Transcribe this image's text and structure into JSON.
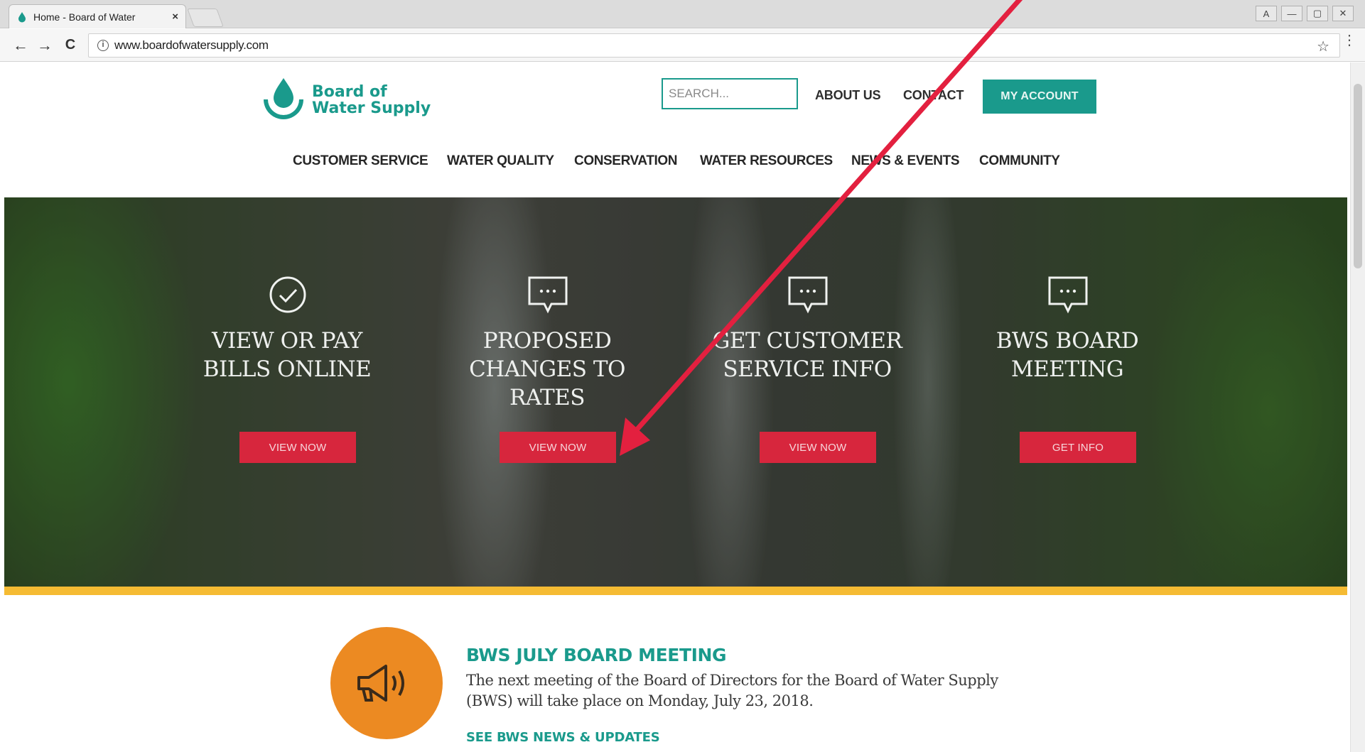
{
  "browser": {
    "tab_title": "Home - Board of Water",
    "tab_close": "×",
    "url": "www.boardofwatersupply.com",
    "info_glyph": "i",
    "star_glyph": "☆",
    "back_glyph": "←",
    "forward_glyph": "→",
    "reload_glyph": "C",
    "menu_glyph": "⋮",
    "window_controls": [
      "A",
      "—",
      "▢",
      "✕"
    ]
  },
  "header": {
    "logo_line1": "Board of",
    "logo_line2": "Water Supply",
    "search_placeholder": "SEARCH...",
    "about_label": "ABOUT US",
    "contact_label": "CONTACT",
    "account_label": "MY ACCOUNT"
  },
  "nav": {
    "items": [
      {
        "label": "CUSTOMER SERVICE"
      },
      {
        "label": "WATER QUALITY"
      },
      {
        "label": "CONSERVATION"
      },
      {
        "label": "WATER RESOURCES"
      },
      {
        "label": "NEWS & EVENTS"
      },
      {
        "label": "COMMUNITY"
      }
    ]
  },
  "hero": {
    "ctas": [
      {
        "icon": "check-circle-icon",
        "title_lines": [
          "VIEW OR PAY",
          "BILLS ONLINE"
        ],
        "button": "VIEW NOW"
      },
      {
        "icon": "chat-bubble-icon",
        "title_lines": [
          "PROPOSED",
          "CHANGES TO",
          "RATES"
        ],
        "button": "VIEW NOW"
      },
      {
        "icon": "chat-bubble-icon",
        "title_lines": [
          "GET CUSTOMER",
          "SERVICE INFO"
        ],
        "button": "VIEW NOW"
      },
      {
        "icon": "chat-bubble-icon",
        "title_lines": [
          "BWS BOARD",
          "MEETING"
        ],
        "button": "GET INFO"
      }
    ]
  },
  "news": {
    "icon": "megaphone-icon",
    "title": "BWS JULY BOARD MEETING",
    "body_line1": "The next meeting of the Board of Directors for the Board of Water Supply",
    "body_line2": "(BWS) will take place on Monday, July 23, 2018.",
    "link": "SEE BWS NEWS & UPDATES"
  },
  "colors": {
    "brand_teal": "#1a9a8c",
    "cta_red": "#d7263d",
    "accent_gold": "#f5bb33",
    "megaphone_orange": "#ec8a22",
    "annotation_arrow": "#e3203f"
  }
}
